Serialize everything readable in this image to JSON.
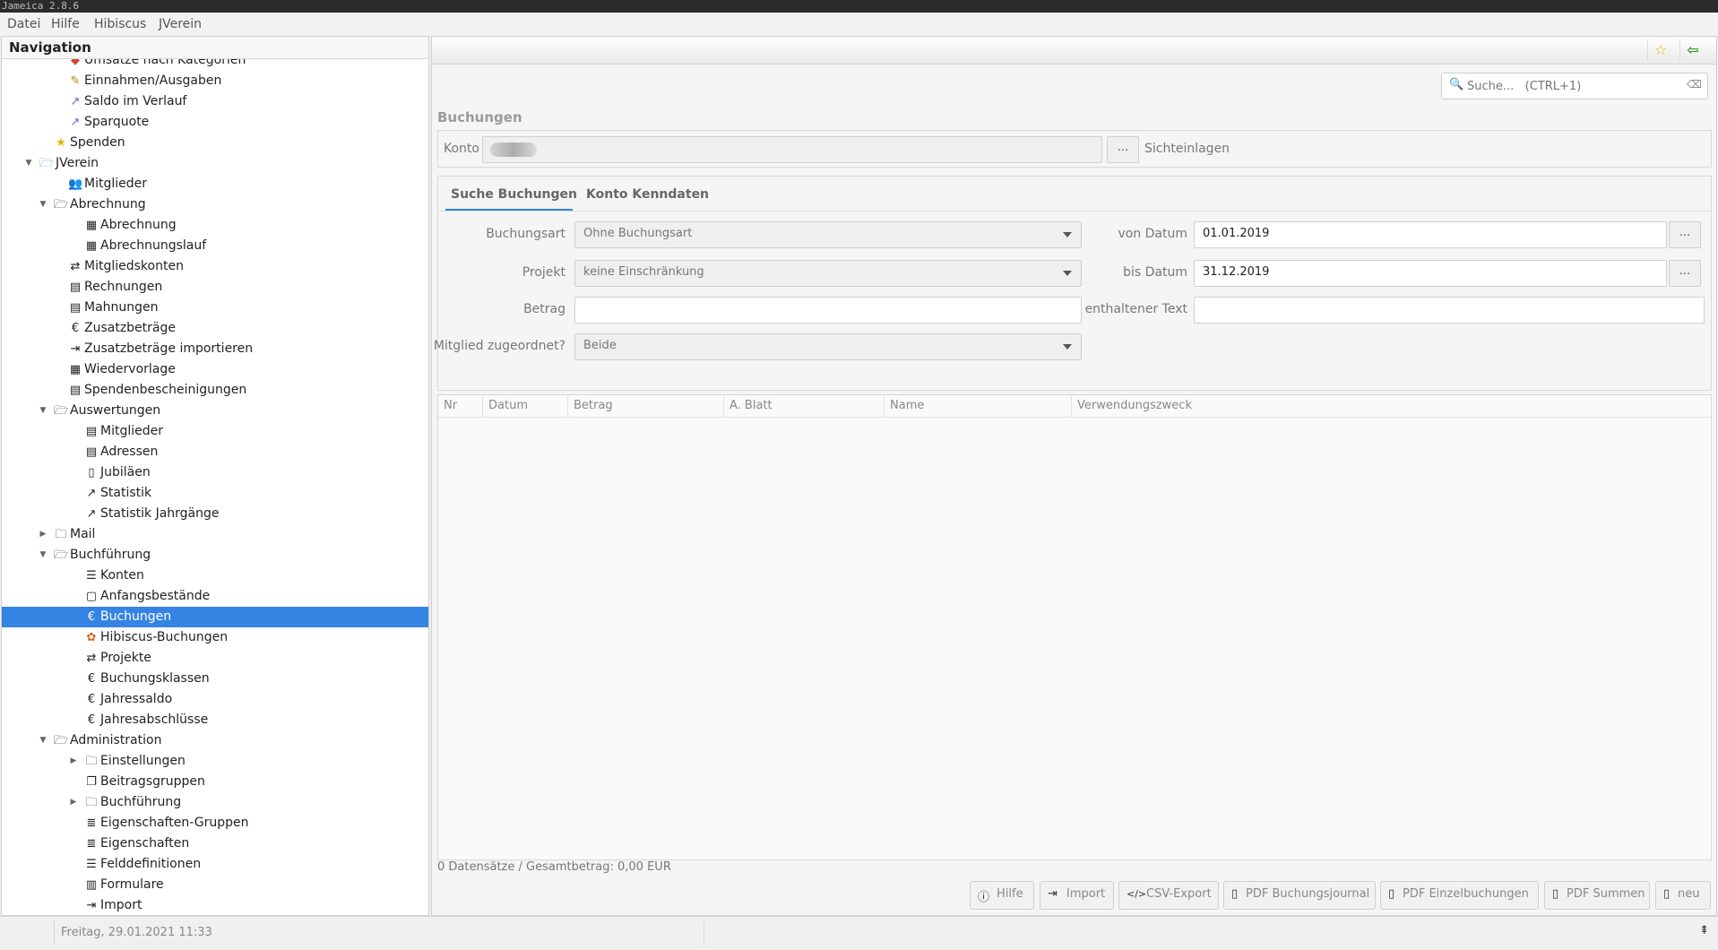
{
  "window": {
    "title": "Jameica 2.8.6"
  },
  "menu": [
    "Datei",
    "Hilfe",
    "Hibiscus",
    "JVerein"
  ],
  "navigation": {
    "title": "Navigation",
    "items": [
      {
        "label": "Umsätze nach Kategorien",
        "level": 3,
        "icon": "category-icon",
        "glyph": "◆",
        "color": "#d04a2a"
      },
      {
        "label": "Einnahmen/Ausgaben",
        "level": 3,
        "icon": "pencil-money-icon",
        "glyph": "✎",
        "color": "#b38a00"
      },
      {
        "label": "Saldo im Verlauf",
        "level": 3,
        "icon": "line-chart-icon",
        "glyph": "↗",
        "color": "#7a56c2"
      },
      {
        "label": "Sparquote",
        "level": 3,
        "icon": "saving-chart-icon",
        "glyph": "↗",
        "color": "#7a56c2"
      },
      {
        "label": "Spenden",
        "level": 2,
        "icon": "star-icon",
        "glyph": "★",
        "color": "#e8b400"
      },
      {
        "label": "JVerein",
        "level": 1,
        "icon": "folder-open-icon",
        "glyph": "🗁",
        "color": "#5a8fd0",
        "twisty": "▼"
      },
      {
        "label": "Mitglieder",
        "level": 3,
        "icon": "members-icon",
        "glyph": "👥",
        "color": "#222"
      },
      {
        "label": "Abrechnung",
        "level": 2,
        "icon": "folder-open-icon",
        "glyph": "🗁",
        "color": "#222",
        "twisty": "▼"
      },
      {
        "label": "Abrechnung",
        "level": 4,
        "icon": "calculator-icon",
        "glyph": "▦",
        "color": "#222"
      },
      {
        "label": "Abrechnungslauf",
        "level": 4,
        "icon": "calculator-icon",
        "glyph": "▦",
        "color": "#222"
      },
      {
        "label": "Mitgliedskonten",
        "level": 3,
        "icon": "transfer-icon",
        "glyph": "⇄",
        "color": "#222"
      },
      {
        "label": "Rechnungen",
        "level": 3,
        "icon": "invoice-icon",
        "glyph": "▤",
        "color": "#222"
      },
      {
        "label": "Mahnungen",
        "level": 3,
        "icon": "reminder-icon",
        "glyph": "▤",
        "color": "#222"
      },
      {
        "label": "Zusatzbeträge",
        "level": 3,
        "icon": "euro-icon",
        "glyph": "€",
        "color": "#222"
      },
      {
        "label": "Zusatzbeträge importieren",
        "level": 3,
        "icon": "import-icon",
        "glyph": "⇥",
        "color": "#222"
      },
      {
        "label": "Wiedervorlage",
        "level": 3,
        "icon": "calendar-icon",
        "glyph": "▦",
        "color": "#222"
      },
      {
        "label": "Spendenbescheinigungen",
        "level": 3,
        "icon": "certificate-icon",
        "glyph": "▤",
        "color": "#222"
      },
      {
        "label": "Auswertungen",
        "level": 2,
        "icon": "folder-open-icon",
        "glyph": "🗁",
        "color": "#222",
        "twisty": "▼"
      },
      {
        "label": "Mitglieder",
        "level": 4,
        "icon": "report-icon",
        "glyph": "▤",
        "color": "#222"
      },
      {
        "label": "Adressen",
        "level": 4,
        "icon": "report-icon",
        "glyph": "▤",
        "color": "#222"
      },
      {
        "label": "Jubiläen",
        "level": 4,
        "icon": "document-icon",
        "glyph": "▯",
        "color": "#222"
      },
      {
        "label": "Statistik",
        "level": 4,
        "icon": "chart-icon",
        "glyph": "↗",
        "color": "#222"
      },
      {
        "label": "Statistik Jahrgänge",
        "level": 4,
        "icon": "chart-icon",
        "glyph": "↗",
        "color": "#222"
      },
      {
        "label": "Mail",
        "level": 2,
        "icon": "folder-icon",
        "glyph": "🗀",
        "color": "#222",
        "twisty": "▶"
      },
      {
        "label": "Buchführung",
        "level": 2,
        "icon": "folder-open-icon",
        "glyph": "🗁",
        "color": "#222",
        "twisty": "▼"
      },
      {
        "label": "Konten",
        "level": 4,
        "icon": "list-icon",
        "glyph": "☰",
        "color": "#222"
      },
      {
        "label": "Anfangsbestände",
        "level": 4,
        "icon": "square-icon",
        "glyph": "▢",
        "color": "#222"
      },
      {
        "label": "Buchungen",
        "level": 4,
        "icon": "euro-icon",
        "glyph": "€",
        "color": "#222",
        "selected": true
      },
      {
        "label": "Hibiscus-Buchungen",
        "level": 4,
        "icon": "hibiscus-icon",
        "glyph": "✿",
        "color": "#d4661a"
      },
      {
        "label": "Projekte",
        "level": 4,
        "icon": "transfer-icon",
        "glyph": "⇄",
        "color": "#222"
      },
      {
        "label": "Buchungsklassen",
        "level": 4,
        "icon": "euro-icon",
        "glyph": "€",
        "color": "#222"
      },
      {
        "label": "Jahressaldo",
        "level": 4,
        "icon": "euro-icon",
        "glyph": "€",
        "color": "#222"
      },
      {
        "label": "Jahresabschlüsse",
        "level": 4,
        "icon": "euro-icon",
        "glyph": "€",
        "color": "#222"
      },
      {
        "label": "Administration",
        "level": 2,
        "icon": "folder-open-icon",
        "glyph": "🗁",
        "color": "#222",
        "twisty": "▼"
      },
      {
        "label": "Einstellungen",
        "level": 4,
        "icon": "folder-icon",
        "glyph": "🗀",
        "color": "#222",
        "twisty": "▶"
      },
      {
        "label": "Beitragsgruppen",
        "level": 4,
        "icon": "groups-icon",
        "glyph": "❐",
        "color": "#222"
      },
      {
        "label": "Buchführung",
        "level": 4,
        "icon": "folder-icon",
        "glyph": "🗀",
        "color": "#222",
        "twisty": "▶"
      },
      {
        "label": "Eigenschaften-Gruppen",
        "level": 4,
        "icon": "database-icon",
        "glyph": "≣",
        "color": "#222"
      },
      {
        "label": "Eigenschaften",
        "level": 4,
        "icon": "database-icon",
        "glyph": "≣",
        "color": "#222"
      },
      {
        "label": "Felddefinitionen",
        "level": 4,
        "icon": "list-icon",
        "glyph": "☰",
        "color": "#222"
      },
      {
        "label": "Formulare",
        "level": 4,
        "icon": "form-icon",
        "glyph": "▥",
        "color": "#222"
      },
      {
        "label": "Import",
        "level": 4,
        "icon": "import-icon",
        "glyph": "⇥",
        "color": "#222"
      }
    ]
  },
  "search": {
    "placeholder": "Suche...   (CTRL+1)"
  },
  "buchungen": {
    "title": "Buchungen",
    "konto_label": "Konto",
    "konto_value": "",
    "konto_button": "...",
    "konto_hint": "Sichteinlagen"
  },
  "tabs": [
    {
      "label": "Suche Buchungen",
      "active": true
    },
    {
      "label": "Konto Kenndaten",
      "active": false
    }
  ],
  "filters": {
    "buchungsart": {
      "label": "Buchungsart",
      "value": "Ohne Buchungsart"
    },
    "projekt": {
      "label": "Projekt",
      "value": "keine Einschränkung"
    },
    "betrag": {
      "label": "Betrag",
      "value": ""
    },
    "mitglied": {
      "label": "Mitglied zugeordnet?",
      "value": "Beide"
    },
    "von_datum": {
      "label": "von Datum",
      "value": "01.01.2019",
      "button": "..."
    },
    "bis_datum": {
      "label": "bis Datum",
      "value": "31.12.2019",
      "button": "..."
    },
    "text": {
      "label": "enthaltener Text",
      "value": ""
    }
  },
  "table": {
    "columns": [
      "Nr",
      "Datum",
      "Betrag",
      "A. Blatt",
      "Name",
      "Verwendungszweck"
    ],
    "rows": []
  },
  "summary": "0 Datensätze / Gesamtbetrag: 0,00 EUR",
  "actions": [
    {
      "label": "Hilfe",
      "icon": "help-icon",
      "glyph": "?"
    },
    {
      "label": "Import",
      "icon": "import-icon",
      "glyph": "⇥"
    },
    {
      "label": "CSV-Export",
      "icon": "code-icon",
      "glyph": "</>"
    },
    {
      "label": "PDF Buchungsjournal",
      "icon": "pdf-icon",
      "glyph": "▯"
    },
    {
      "label": "PDF Einzelbuchungen",
      "icon": "pdf-icon",
      "glyph": "▯"
    },
    {
      "label": "PDF Summen",
      "icon": "pdf-icon",
      "glyph": "▯"
    },
    {
      "label": "neu",
      "icon": "new-document-icon",
      "glyph": "▯"
    }
  ],
  "status": {
    "datetime": "Freitag, 29.01.2021 11:33"
  },
  "colors": {
    "accent": "#3584e4",
    "favorite": "#e8b400",
    "back": "#3a9a2a"
  }
}
